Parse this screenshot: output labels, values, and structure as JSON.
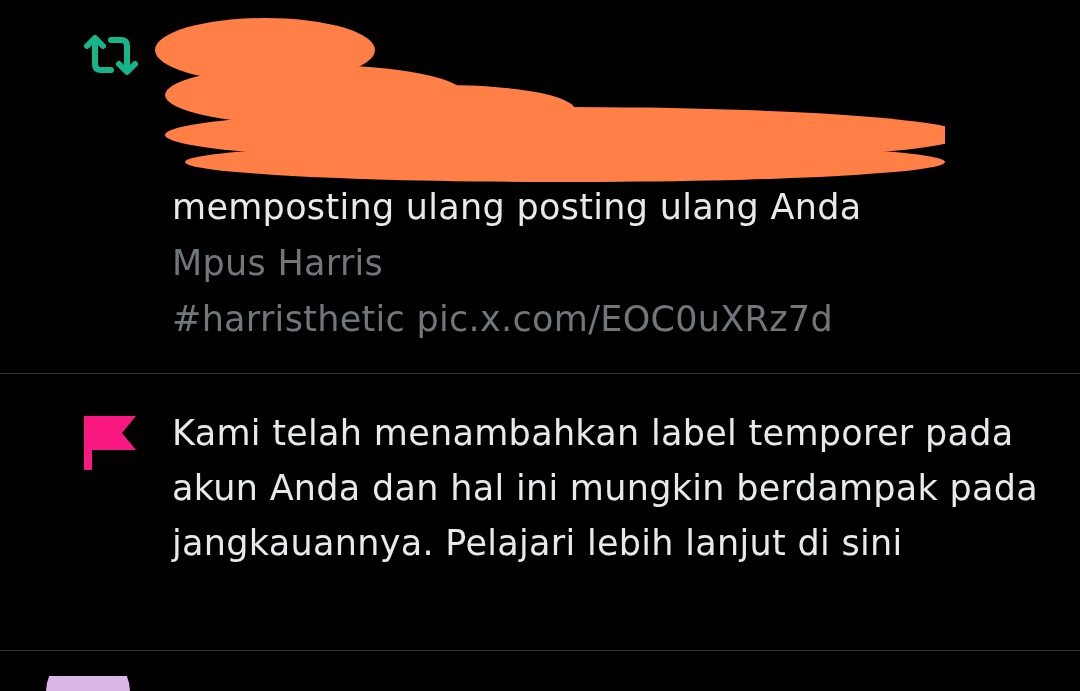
{
  "notifications": [
    {
      "kind": "repost",
      "redacted": true,
      "text": "memposting ulang posting ulang Anda",
      "author": "Mpus Harris",
      "post_text": "#harristhetic pic.x.com/EOC0uXRz7d"
    },
    {
      "kind": "notice",
      "text": "Kami telah menambahkan label temporer pada akun Anda dan hal ini mungkin berdampak pada jangkauannya. Pelajari lebih lanjut di sini"
    },
    {
      "kind": "cut-off"
    }
  ]
}
